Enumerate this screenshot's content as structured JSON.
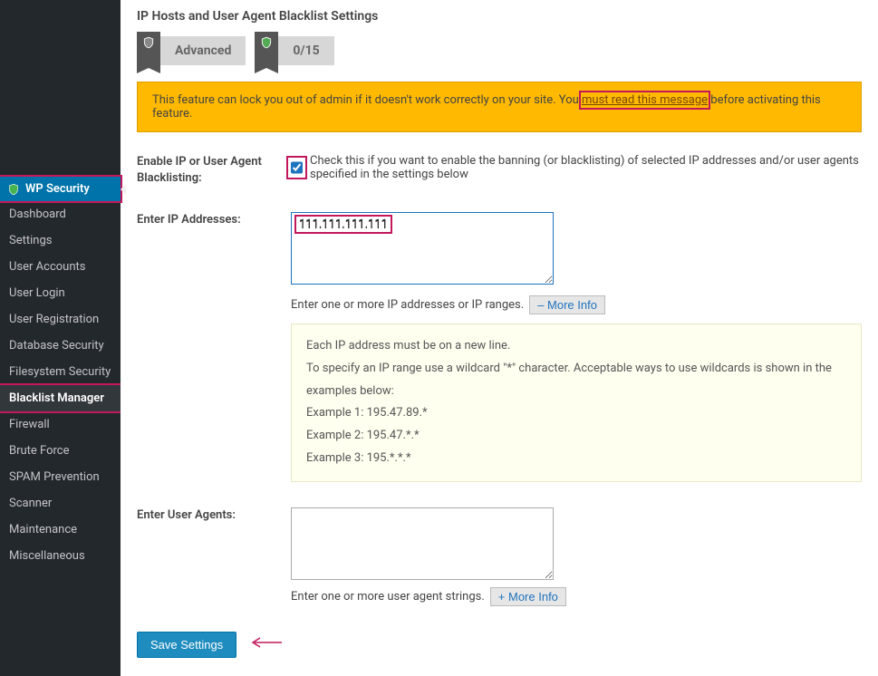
{
  "sidebar": {
    "header": "WP Security",
    "items": [
      "Dashboard",
      "Settings",
      "User Accounts",
      "User Login",
      "User Registration",
      "Database Security",
      "Filesystem Security",
      "Blacklist Manager",
      "Firewall",
      "Brute Force",
      "SPAM Prevention",
      "Scanner",
      "Maintenance",
      "Miscellaneous"
    ],
    "activeIndex": 7
  },
  "page": {
    "title": "IP Hosts and User Agent Blacklist Settings",
    "badge_advanced": "Advanced",
    "badge_score": "0/15"
  },
  "notice": {
    "pre": "This feature can lock you out of admin if it doesn't work correctly on your site. You ",
    "link": "must read this message",
    "post": " before activating this feature."
  },
  "form": {
    "enable_label": "Enable IP or User Agent Blacklisting:",
    "enable_checked": true,
    "enable_help": "Check this if you want to enable the banning (or blacklisting) of selected IP addresses and/or user agents specified in the settings below",
    "ip_label": "Enter IP Addresses:",
    "ip_value": "111.111.111.111",
    "ip_help": "Enter one or more IP addresses or IP ranges.",
    "ip_more_btn": "–  More Info",
    "info_lines": [
      "Each IP address must be on a new line.",
      "To specify an IP range use a wildcard \"*\" character. Acceptable ways to use wildcards is shown in the examples below:",
      "Example 1: 195.47.89.*",
      "Example 2: 195.47.*.*",
      "Example 3: 195.*.*.*"
    ],
    "ua_label": "Enter User Agents:",
    "ua_value": "",
    "ua_help": "Enter one or more user agent strings.",
    "ua_more_btn": "+  More Info",
    "save_btn": "Save Settings"
  }
}
